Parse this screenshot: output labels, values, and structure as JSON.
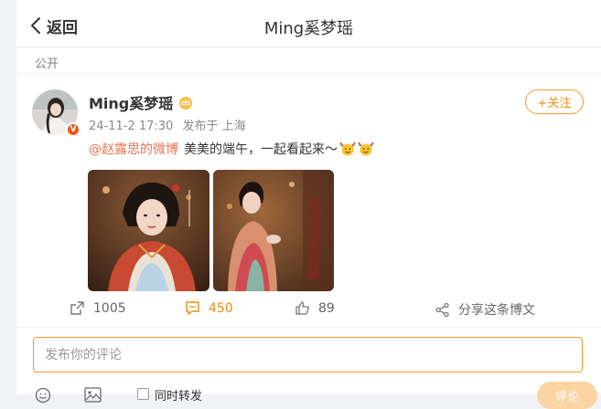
{
  "header": {
    "back_label": "返回",
    "title": "Ming奚梦瑶"
  },
  "post": {
    "visibility": "公开",
    "author": "Ming奚梦瑶",
    "time": "24-11-2 17:30",
    "source": "发布于 上海",
    "follow_label": "+关注",
    "verified_badge": "V",
    "mention": "@赵露思的微博",
    "text": "美美的端午，一起看起来～",
    "emojis": [
      "party-emoji",
      "party-emoji"
    ],
    "images": [
      "portrait-photo-1",
      "portrait-photo-2"
    ]
  },
  "actions": {
    "repost_count": "1005",
    "comment_count": "450",
    "like_count": "89",
    "share_label": "分享这条博文"
  },
  "comment": {
    "placeholder": "发布你的评论",
    "sync_label": "同时转发",
    "submit_label": "评论"
  },
  "colors": {
    "accent": "#f08a12",
    "mention": "#eb7350",
    "badge": "#e8581c"
  }
}
